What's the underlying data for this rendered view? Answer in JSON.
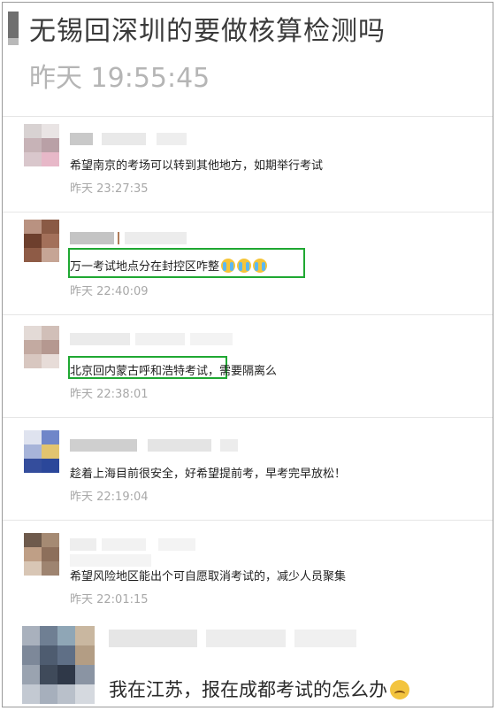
{
  "header": {
    "title": "无锡回深圳的要做核算检测吗",
    "time": "昨天 19:55:45"
  },
  "comments": [
    {
      "text": "希望南京的考场可以转到其他地方，如期举行考试",
      "time": "昨天 23:27:35"
    },
    {
      "text": "万一考试地点分在封控区咋整",
      "time": "昨天 22:40:09",
      "emoji": "crying-face-icon"
    },
    {
      "text_highlight": "北京回内蒙古呼和浩特考试",
      "text_rest": "，需要隔离么",
      "time": "昨天 22:38:01"
    },
    {
      "text": "趁着上海目前很安全，好希望提前考，早考完早放松！",
      "time": "昨天 22:19:04"
    },
    {
      "text": "希望风险地区能出个可自愿取消考试的，减少人员聚集",
      "time": "昨天 22:01:15"
    }
  ],
  "last_comment": {
    "text": "我在江苏，报在成都考试的怎么办",
    "emoji": "sad-face-icon"
  },
  "colors": {
    "highlight": "#1fa832",
    "timestamp": "#a8a8a8"
  }
}
